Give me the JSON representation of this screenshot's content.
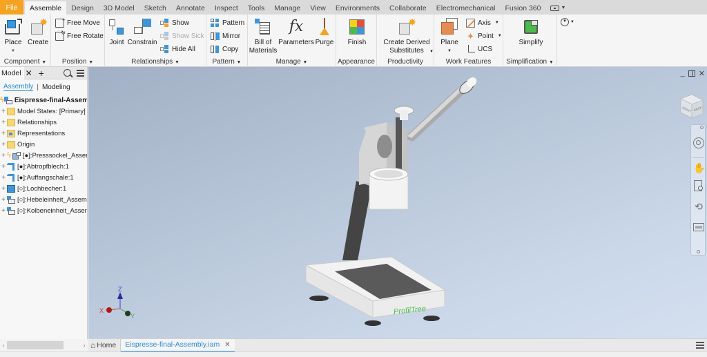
{
  "tabs": [
    "File",
    "Assemble",
    "Design",
    "3D Model",
    "Sketch",
    "Annotate",
    "Inspect",
    "Tools",
    "Manage",
    "View",
    "Environments",
    "Collaborate",
    "Electromechanical",
    "Fusion 360"
  ],
  "active_tab": "Assemble",
  "ribbon": {
    "component": {
      "label": "Component",
      "place": "Place",
      "create": "Create"
    },
    "position": {
      "label": "Position",
      "free_move": "Free Move",
      "free_rotate": "Free Rotate"
    },
    "relationships": {
      "label": "Relationships",
      "joint": "Joint",
      "constrain": "Constrain",
      "show": "Show",
      "show_sick": "Show Sick",
      "hide_all": "Hide All"
    },
    "pattern": {
      "label": "Pattern",
      "pattern": "Pattern",
      "mirror": "Mirror",
      "copy": "Copy"
    },
    "manage": {
      "label": "Manage",
      "bom_line1": "Bill of",
      "bom_line2": "Materials",
      "parameters": "Parameters",
      "purge": "Purge"
    },
    "appearance": {
      "label": "Appearance",
      "finish": "Finish"
    },
    "productivity": {
      "label": "Productivity",
      "cds_line1": "Create Derived",
      "cds_line2": "Substitutes"
    },
    "work_features": {
      "label": "Work Features",
      "plane": "Plane",
      "axis": "Axis",
      "point": "Point",
      "ucs": "UCS"
    },
    "simplification": {
      "label": "Simplification",
      "simplify": "Simplify"
    }
  },
  "browser": {
    "tab_label": "Model",
    "subtabs": [
      "Assembly",
      "Modeling"
    ],
    "root": "Eispresse-final-Assembly",
    "items": [
      {
        "label": "Model States: [Primary]",
        "icon": "folder"
      },
      {
        "label": "Relationships",
        "icon": "folder"
      },
      {
        "label": "Representations",
        "icon": "representations"
      },
      {
        "label": "Origin",
        "icon": "folder"
      },
      {
        "label": "[●]:Presssockel_Assembly",
        "icon": "subassembly"
      },
      {
        "label": "[●]:Abtropfblech:1",
        "icon": "sheetmetal"
      },
      {
        "label": "[●]:Auffangschale:1",
        "icon": "sheetmetal"
      },
      {
        "label": "[○]:Lochbecher:1",
        "icon": "part"
      },
      {
        "label": "[○]:Hebeleinheit_Assembly",
        "icon": "assembly"
      },
      {
        "label": "[○]:Kolbeneinheit_Assembly",
        "icon": "assembly"
      }
    ]
  },
  "doc_tabs": {
    "home": "Home",
    "active": "Eispresse-final-Assembly.iam"
  },
  "viewport": {
    "viewcube": {
      "faces": [
        "RIGHT",
        "BACK"
      ]
    },
    "triad": {
      "x": "X",
      "y": "Y",
      "z": "Z"
    },
    "model_brand": "ProfilTree"
  },
  "colors": {
    "file_tab": "#f5a321",
    "accent": "#2a8bd6",
    "brand_text": "#4cbb4c"
  }
}
